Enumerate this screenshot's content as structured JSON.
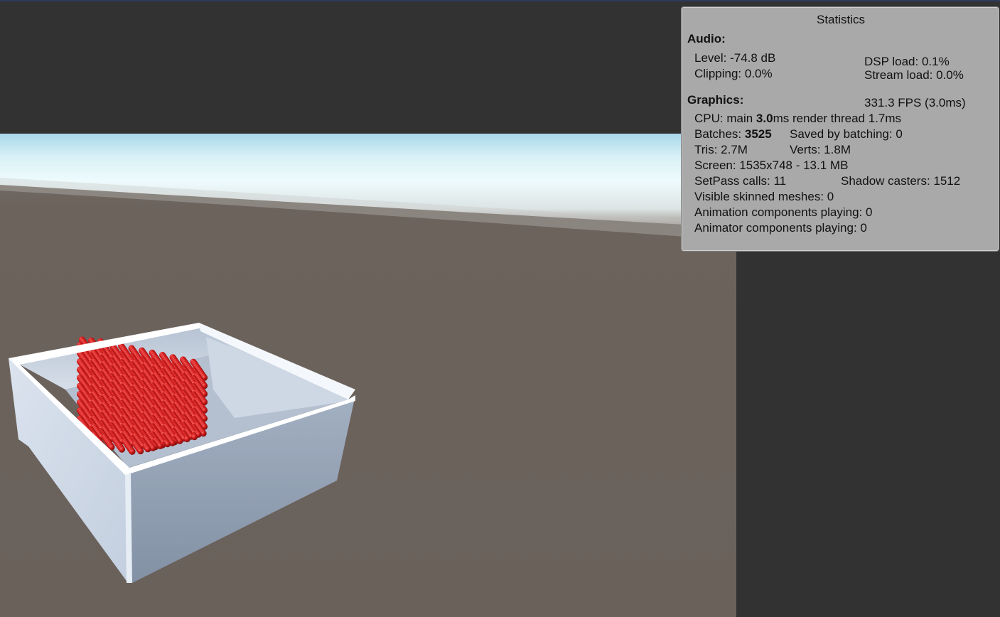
{
  "stats": {
    "title": "Statistics",
    "audio": {
      "heading": "Audio:",
      "level": "Level: -74.8 dB",
      "clipping": "Clipping: 0.0%",
      "dsp_load": "DSP load: 0.1%",
      "stream_load": "Stream load: 0.0%"
    },
    "graphics": {
      "heading": "Graphics:",
      "fps": "331.3 FPS (3.0ms)",
      "cpu_prefix": "CPU: main ",
      "cpu_main": "3.0",
      "cpu_suffix": "ms  render thread 1.7ms",
      "batches_prefix": "Batches: ",
      "batches": "3525",
      "saved_by_batching": "Saved by batching: 0",
      "tris": "Tris: 2.7M",
      "verts": "Verts: 1.8M",
      "screen": "Screen: 1535x748 - 13.1 MB",
      "setpass": "SetPass calls: 11",
      "shadow_casters": "Shadow casters: 1512",
      "skinned_meshes": "Visible skinned meshes: 0",
      "animation_components": "Animation components playing: 0",
      "animator_components": "Animator components playing: 0"
    }
  },
  "colors": {
    "editor_bg": "#323232",
    "ground": "#6b625c",
    "sky_horizon": "#e3f7fb",
    "container": "#a8b8cc",
    "spheres": "#c81c1c",
    "panel_bg": "#a9a9a9"
  }
}
